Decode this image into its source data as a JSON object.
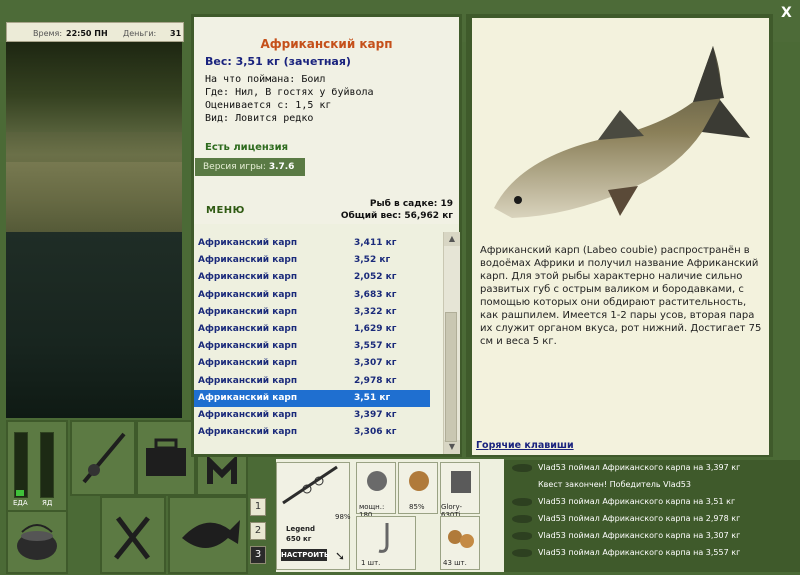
{
  "topbar": {
    "time_label": "Время:",
    "time_value": "22:50 ПН",
    "money_label": "Деньги:",
    "money_value": "31"
  },
  "meters": {
    "food_label": "ЕДА",
    "poison_label": "ЯД"
  },
  "pages": [
    "1",
    "2",
    "3"
  ],
  "fish_info": {
    "title": "Африканский карп",
    "weight": "Вес: 3,51 кг (зачетная)",
    "caught_on": "На что поймана: Боил",
    "where": "Где: Нил, В гостях у буйвола",
    "valued_from": "Оценивается с: 1,5 кг",
    "kind": "Вид: Ловится редко"
  },
  "license": "Есть лицензия",
  "version_label": "Версия игры:",
  "version_value": "3.7.6",
  "menu_label": "МЕНЮ",
  "stats": {
    "count": "Рыб в садке: 19",
    "total": "Общий вес: 56,962 кг"
  },
  "catch_list": [
    {
      "name": "Африканский карп",
      "weight": "3,411 кг"
    },
    {
      "name": "Африканский карп",
      "weight": "3,52 кг"
    },
    {
      "name": "Африканский карп",
      "weight": "2,052 кг"
    },
    {
      "name": "Африканский карп",
      "weight": "3,683 кг"
    },
    {
      "name": "Африканский карп",
      "weight": "3,322 кг"
    },
    {
      "name": "Африканский карп",
      "weight": "1,629 кг"
    },
    {
      "name": "Африканский карп",
      "weight": "3,557 кг"
    },
    {
      "name": "Африканский карп",
      "weight": "3,307 кг"
    },
    {
      "name": "Африканский карп",
      "weight": "2,978 кг"
    },
    {
      "name": "Африканский карп",
      "weight": "3,51 кг"
    },
    {
      "name": "Африканский карп",
      "weight": "3,397 кг"
    },
    {
      "name": "Африканский карп",
      "weight": "3,306 кг"
    }
  ],
  "selected_index": 9,
  "description": "Африканский карп (Labeo coubie) распространён в водоёмах Африки и получил название Африканский карп. Для этой рыбы характерно наличие сильно развитых губ с острым валиком и бородавками, с помощью которых они обдирают растительность, как рашпилем. Имеется 1-2 пары усов, вторая пара их служит органом вкуса, рот нижний. Достигает 75 см и веса 5 кг.",
  "hotkeys": "Горячие клавиши",
  "close": "X",
  "tackle": {
    "rod_name": "Legend",
    "rod_load": "650 кг",
    "rod_percent": "98%",
    "setup_button": "НАСТРОИТЬ",
    "reel_power": "мощн.: 180",
    "reel_percent": "85%",
    "line_name": "Glory-630Ti",
    "hook_count": "1 шт.",
    "bait_count": "43 шт."
  },
  "log": [
    "Vlad53 поймал Африканского карпа на 3,397 кг",
    "Квест закончен! Победитель Vlad53",
    "Vlad53 поймал Африканского карпа на 3,51 кг",
    "Vlad53 поймал Африканского карпа на 2,978 кг",
    "Vlad53 поймал Африканского карпа на 3,307 кг",
    "Vlad53 поймал Африканского карпа на 3,557 кг"
  ],
  "colors": {
    "title": "#c5501a",
    "weight": "#1a237e",
    "license": "#2e6b1e",
    "selection": "#1f6fd0",
    "frame": "#3f5a2b"
  }
}
